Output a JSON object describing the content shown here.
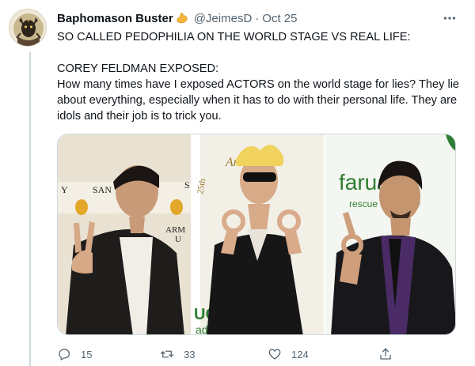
{
  "author": {
    "display_name": "Baphomason Buster",
    "name_emoji_icon": "flexed-biceps-icon",
    "handle": "@JeimesD",
    "separator": "·",
    "date": "Oct 25",
    "avatar_icon": "baphomet-avatar-icon"
  },
  "more_icon": "more-dots-icon",
  "tweet": {
    "line1": "SO CALLED PEDOPHILIA ON THE WORLD STAGE VS REAL LIFE:",
    "line2": "COREY FELDMAN EXPOSED:",
    "line3": "How many times have I exposed ACTORS on the world stage for lies? They lie about everything, especially when it has to do with their personal life. They are idols and their job is to trick you."
  },
  "media": {
    "panel1_sign_text_1": "Y",
    "panel1_sign_text_2": "SAN",
    "panel1_sign_text_3": "S",
    "panel1_sign_text_4": "ARM",
    "panel1_sign_text_5": "U",
    "panel2_sign_text_1": "An",
    "panel2_sign_text_2": "25th",
    "panel2_sign_text_3": "UC",
    "panel2_sign_text_4": "ad",
    "panel3_sign_text_1": "faruary",
    "panel3_sign_text_2": "rescue advocacy"
  },
  "actions": {
    "reply": {
      "icon": "reply-icon",
      "count": "15"
    },
    "retweet": {
      "icon": "retweet-icon",
      "count": "33"
    },
    "like": {
      "icon": "heart-icon",
      "count": "124"
    },
    "share": {
      "icon": "share-icon"
    }
  },
  "colors": {
    "text_primary": "#0f1419",
    "text_secondary": "#536471",
    "border": "#cfd9de",
    "brand_green": "#2e7d32"
  }
}
